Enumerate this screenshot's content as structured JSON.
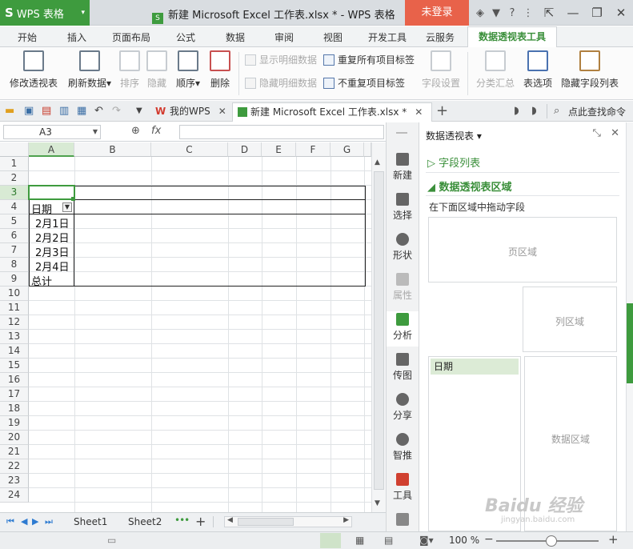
{
  "titlebar": {
    "app_label": "WPS 表格",
    "doc_title": "新建 Microsoft Excel 工作表.xlsx * - WPS 表格",
    "login_label": "未登录"
  },
  "menu": {
    "items": [
      "开始",
      "插入",
      "页面布局",
      "公式",
      "数据",
      "审阅",
      "视图",
      "开发工具",
      "云服务"
    ],
    "active": "数据透视表工具"
  },
  "ribbon": {
    "modify": "修改透视表",
    "refresh": "刷新数据",
    "sort": "排序",
    "hide": "隐藏",
    "order": "顺序",
    "delete": "删除",
    "show_detail": "显示明细数据",
    "hide_detail": "隐藏明细数据",
    "repeat_labels": "重复所有项目标签",
    "no_repeat_labels": "不重复项目标签",
    "field_settings": "字段设置",
    "subtotal": "分类汇总",
    "table_options": "表选项",
    "hide_field_list": "隐藏字段列表"
  },
  "tabs": {
    "my_wps": "我的WPS",
    "current_doc": "新建 Microsoft Excel 工作表.xlsx *",
    "search": "点此查找命令"
  },
  "formula": {
    "cell_ref": "A3",
    "fx": "fx",
    "value": ""
  },
  "grid": {
    "columns": [
      "A",
      "B",
      "C",
      "D",
      "E",
      "F",
      "G"
    ],
    "rows": [
      "1",
      "2",
      "3",
      "4",
      "5",
      "6",
      "7",
      "8",
      "9",
      "10",
      "11",
      "12",
      "13",
      "14",
      "15",
      "16",
      "17",
      "18",
      "19",
      "20",
      "21",
      "22",
      "23",
      "24"
    ],
    "selected_col": "A",
    "selected_row": "3",
    "pivot": {
      "header": "日期",
      "items": [
        "2月1日",
        "2月2日",
        "2月3日",
        "2月4日"
      ],
      "total": "总计"
    }
  },
  "sheets": [
    "Sheet1",
    "Sheet2"
  ],
  "sidebar": [
    "新建",
    "选择",
    "形状",
    "属性",
    "分析",
    "传图",
    "分享",
    "智推",
    "工具"
  ],
  "pane": {
    "title": "数据透视表",
    "field_list": "字段列表",
    "area_title": "数据透视表区域",
    "hint": "在下面区域中拖动字段",
    "page_zone": "页区域",
    "col_zone": "列区域",
    "row_zone_item": "日期",
    "data_zone": "数据区域"
  },
  "status": {
    "zoom": "100 %"
  },
  "watermark": {
    "text": "Baidu 经验",
    "url": "jingyan.baidu.com"
  }
}
